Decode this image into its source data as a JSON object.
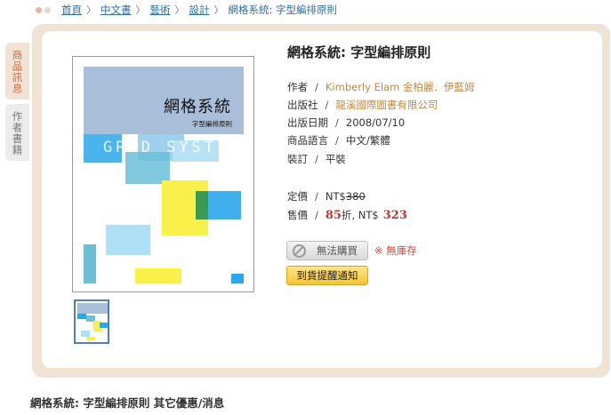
{
  "breadcrumb": {
    "items": [
      "首頁",
      "中文書",
      "藝術",
      "設計"
    ],
    "current": "網格系統: 字型編排原則",
    "separator": "〉"
  },
  "tabs": [
    {
      "label": "商品訊息",
      "active": true
    },
    {
      "label": "作者書籍",
      "active": false
    }
  ],
  "cover": {
    "title": "網格系統",
    "subtitle": "字型編排原則",
    "grid_text": "GRID SYSTEM"
  },
  "book": {
    "title": "網格系統: 字型編排原則",
    "author_label": "作者",
    "author": "Kimberly Elam 金柏麗．伊藍姆",
    "publisher_label": "出版社",
    "publisher": "龍溪國際圖書有限公司",
    "date_label": "出版日期",
    "date": "2008/07/10",
    "language_label": "商品語言",
    "language": "中文/繁體",
    "binding_label": "裝訂",
    "binding": "平裝",
    "list_price_label": "定價",
    "list_price_prefix": "NT$",
    "list_price": "380",
    "sale_label": "售價",
    "discount": "85",
    "discount_suffix": "折, NT$",
    "sale_price": "323",
    "slash": "/"
  },
  "buttons": {
    "cannot_buy": "無法購買",
    "out_of_stock": "※ 無庫存",
    "notify": "到貨提醒通知"
  },
  "section": {
    "title": "網格系統: 字型編排原則 其它優惠/消息"
  },
  "colors": {
    "panel_bg": "#f0e3d6",
    "accent_orange": "#d06a3c",
    "link_blue": "#2d6fa8",
    "price_red": "#c8322e",
    "notify_yellow": "#f5c533"
  }
}
